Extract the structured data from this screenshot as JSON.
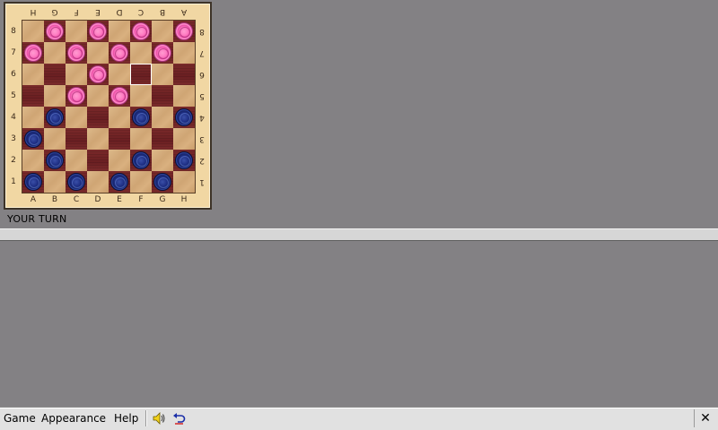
{
  "board": {
    "files_bottom": [
      "A",
      "B",
      "C",
      "D",
      "E",
      "F",
      "G",
      "H"
    ],
    "files_top": [
      "H",
      "G",
      "F",
      "E",
      "D",
      "C",
      "B",
      "A"
    ],
    "ranks": [
      "8",
      "7",
      "6",
      "5",
      "4",
      "3",
      "2",
      "1"
    ],
    "selected_square": "F6",
    "player_colors": {
      "pink": "#ff7ac2",
      "blue": "#1f2f84"
    },
    "pieces": [
      {
        "square": "B8",
        "color": "pink"
      },
      {
        "square": "D8",
        "color": "pink"
      },
      {
        "square": "F8",
        "color": "pink"
      },
      {
        "square": "H8",
        "color": "pink"
      },
      {
        "square": "A7",
        "color": "pink"
      },
      {
        "square": "C7",
        "color": "pink"
      },
      {
        "square": "E7",
        "color": "pink"
      },
      {
        "square": "G7",
        "color": "pink"
      },
      {
        "square": "D6",
        "color": "pink"
      },
      {
        "square": "C5",
        "color": "pink"
      },
      {
        "square": "E5",
        "color": "pink"
      },
      {
        "square": "B4",
        "color": "blue"
      },
      {
        "square": "F4",
        "color": "blue"
      },
      {
        "square": "H4",
        "color": "blue"
      },
      {
        "square": "A3",
        "color": "blue"
      },
      {
        "square": "B2",
        "color": "blue"
      },
      {
        "square": "F2",
        "color": "blue"
      },
      {
        "square": "H2",
        "color": "blue"
      },
      {
        "square": "A1",
        "color": "blue"
      },
      {
        "square": "C1",
        "color": "blue"
      },
      {
        "square": "E1",
        "color": "blue"
      },
      {
        "square": "G1",
        "color": "blue"
      }
    ]
  },
  "status": {
    "text": "YOUR TURN"
  },
  "menubar": {
    "game_label": "Game",
    "appearance_label": "Appearance",
    "help_label": "Help",
    "sound_icon": "speaker-icon",
    "undo_icon": "undo-icon",
    "close_glyph": "✕"
  }
}
